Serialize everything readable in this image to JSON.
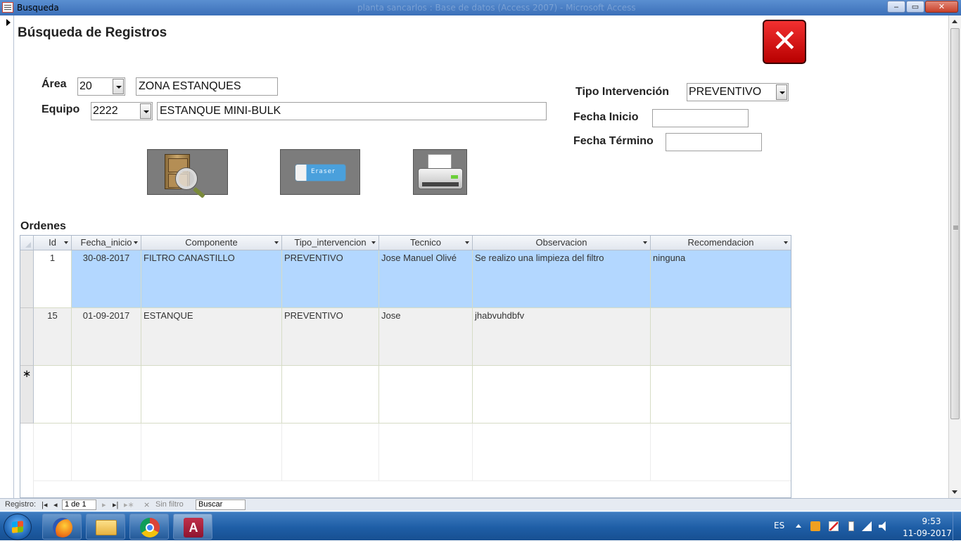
{
  "window": {
    "title": "Busqueda",
    "faint_title": "planta sancarlos : Base de datos (Access 2007) - Microsoft Access",
    "min_label": "‒",
    "max_label": "▭",
    "close_label": "✕"
  },
  "form": {
    "title": "Búsqueda de Registros",
    "close_glyph": "✕",
    "area_label": "Área",
    "area_code": "20",
    "area_name": "ZONA ESTANQUES",
    "equipo_label": "Equipo",
    "equipo_code": "2222",
    "equipo_name": "ESTANQUE MINI-BULK",
    "tipo_label": "Tipo Intervención",
    "tipo_value": "PREVENTIVO",
    "fecha_inicio_label": "Fecha Inicio",
    "fecha_inicio_value": "",
    "fecha_termino_label": "Fecha Término",
    "fecha_termino_value": "",
    "eraser_text": "Eraser",
    "orders_label": "Ordenes"
  },
  "grid": {
    "columns": [
      "Id",
      "Fecha_inicio",
      "Componente",
      "Tipo_intervencion",
      "Tecnico",
      "Observacion",
      "Recomendacion"
    ],
    "rows": [
      {
        "id": "1",
        "fecha": "30-08-2017",
        "componente": "FILTRO CANASTILLO",
        "tipo": "PREVENTIVO",
        "tecnico": "Jose Manuel Olivé",
        "observacion": "Se realizo una limpieza del filtro",
        "recomendacion": "ninguna"
      },
      {
        "id": "15",
        "fecha": "01-09-2017",
        "componente": "ESTANQUE",
        "tipo": "PREVENTIVO",
        "tecnico": "Jose",
        "observacion": "jhabvuhdbfv",
        "recomendacion": ""
      }
    ],
    "new_row_marker": "∗"
  },
  "navbar": {
    "record_label": "Registro:",
    "first": "|◂",
    "prev": "◂",
    "record_value": "1 de 1",
    "next": "▸",
    "last": "▸|",
    "new": "▸∗",
    "filter_label": "Sin filtro",
    "search_value": "Buscar"
  },
  "taskbar": {
    "lang": "ES",
    "time": "9:53",
    "date": "11-09-2017",
    "access_letter": "A"
  }
}
